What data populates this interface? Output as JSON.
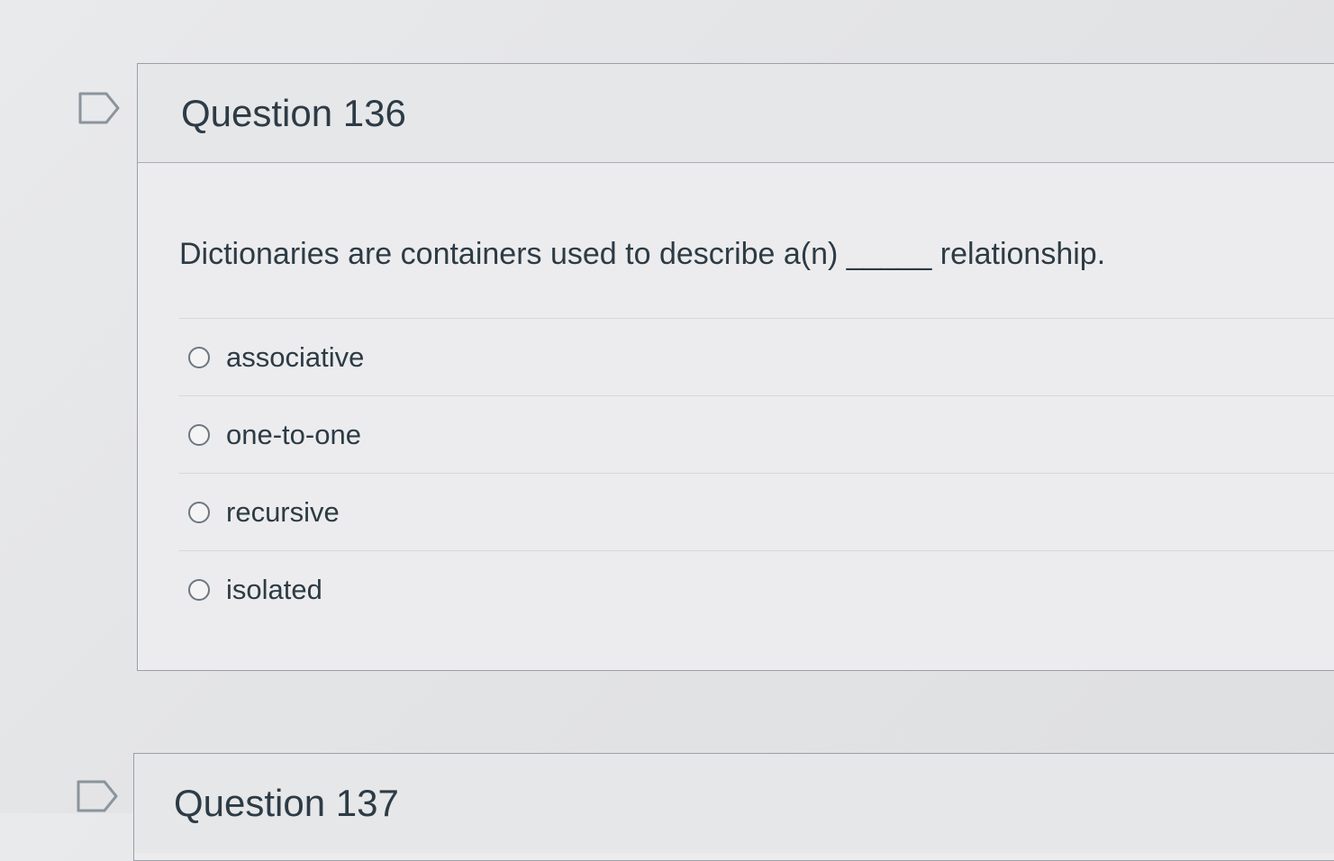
{
  "questions": [
    {
      "title": "Question 136",
      "prompt": "Dictionaries are containers used to describe a(n) _____ relationship.",
      "answers": [
        {
          "label": "associative",
          "selected": false
        },
        {
          "label": "one-to-one",
          "selected": false
        },
        {
          "label": "recursive",
          "selected": false
        },
        {
          "label": "isolated",
          "selected": false
        }
      ]
    },
    {
      "title": "Question 137"
    }
  ],
  "icons": {
    "flag": "flag-question-icon"
  }
}
